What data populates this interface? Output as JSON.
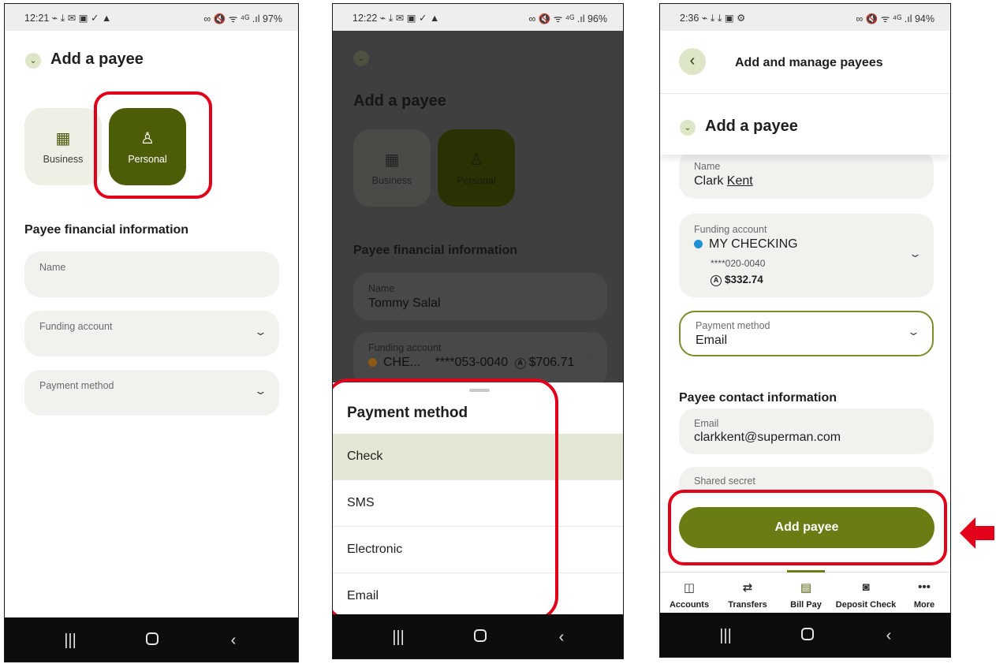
{
  "panel1": {
    "status": {
      "time": "12:21",
      "icons_left": "⌁ ⤓ ✉ ▣ ✓ ▲",
      "icons_right": "∞ 🔇 ᯤ ⁴ᴳ .ıl",
      "battery": "97%"
    },
    "title": "Add a payee",
    "payee_types": [
      {
        "label": "Business",
        "icon": "building-icon"
      },
      {
        "label": "Personal",
        "icon": "person-icon"
      }
    ],
    "section_title": "Payee financial information",
    "fields": {
      "name_label": "Name",
      "funding_label": "Funding account",
      "payment_label": "Payment method"
    }
  },
  "panel2": {
    "status": {
      "time": "12:22",
      "icons_left": "⌁ ⤓ ✉ ▣ ✓ ▲",
      "icons_right": "∞ 🔇 ᯤ ⁴ᴳ .ıl",
      "battery": "96%"
    },
    "title": "Add a payee",
    "payee_types": [
      {
        "label": "Business"
      },
      {
        "label": "Personal"
      }
    ],
    "section_title": "Payee financial information",
    "name_label": "Name",
    "name_value": "Tommy Salal",
    "funding_label": "Funding account",
    "funding_account": "CHE...",
    "funding_number": "****053-0040",
    "funding_balance": "$706.71",
    "funding_dot_color": "#d98a1f",
    "sheet_title": "Payment method",
    "options": [
      "Check",
      "SMS",
      "Electronic",
      "Email"
    ],
    "selected_option": "Check"
  },
  "panel3": {
    "status": {
      "time": "2:36",
      "icons_left": "⌁ ⤓ ⤓ ▣ ⚙",
      "icons_right": "∞ 🔇 ᯤ ⁴ᴳ .ıl",
      "battery": "94%"
    },
    "top_title": "Add and manage payees",
    "title": "Add a payee",
    "name_label": "Name",
    "name_first": "Clark",
    "name_last": "Kent",
    "funding_label": "Funding account",
    "account_name": "MY CHECKING",
    "account_number": "****020-0040",
    "account_balance": "$332.74",
    "account_dot_color": "#1e90d6",
    "payment_label": "Payment method",
    "payment_value": "Email",
    "contact_section": "Payee contact information",
    "email_label": "Email",
    "email_value": "clarkkent@superman.com",
    "secret_label": "Shared secret",
    "add_button": "Add payee",
    "tabs": [
      "Accounts",
      "Transfers",
      "Bill Pay",
      "Deposit Check",
      "More"
    ],
    "active_tab": "Bill Pay"
  },
  "colors": {
    "brand_green": "#6a7c14",
    "dark_green": "#4b5d07",
    "highlight_red": "#e3001b"
  }
}
